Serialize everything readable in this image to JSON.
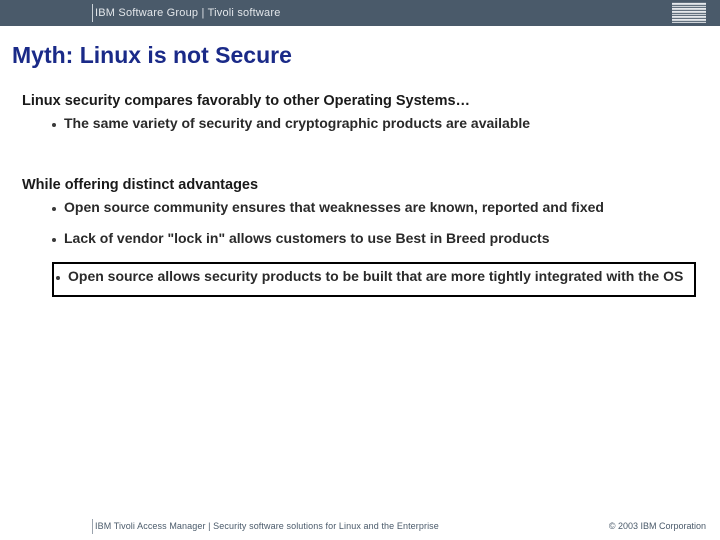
{
  "header": {
    "text": "IBM Software Group  |  Tivoli software",
    "logo_alt": "IBM"
  },
  "title": "Myth: Linux is not Secure",
  "section1": {
    "heading": "Linux security compares favorably to other Operating Systems…",
    "bullets": [
      "The same variety of security and cryptographic products are available"
    ]
  },
  "section2": {
    "heading": "While offering distinct advantages",
    "bullets": [
      "Open source community ensures that weaknesses are known, reported and fixed",
      "Lack of vendor \"lock in\" allows customers to use Best in Breed products"
    ],
    "highlight": "Open source allows security products to be built that are more tightly integrated with the OS"
  },
  "footer": {
    "left": "IBM Tivoli Access Manager  |  Security software solutions for Linux and the Enterprise",
    "right": "© 2003 IBM Corporation"
  }
}
